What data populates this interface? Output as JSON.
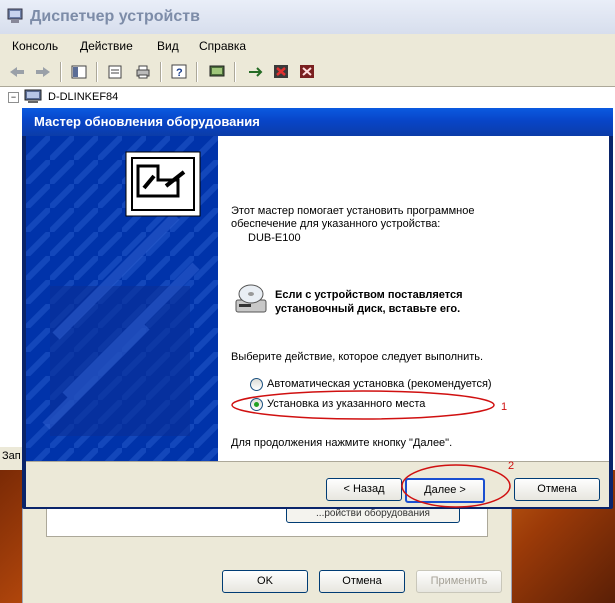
{
  "device_manager": {
    "title": "Диспетчер устройств",
    "menu": [
      "Консоль",
      "Действие",
      "Вид",
      "Справка"
    ],
    "toolbar_icons": [
      "back-icon",
      "forward-icon",
      "show-hide-tree-icon",
      "properties-icon",
      "print-icon",
      "help-icon",
      "scan-hardware-icon",
      "update-driver-icon",
      "disable-device-icon",
      "uninstall-device-icon"
    ],
    "tree_root": "D-DLINKEF84",
    "status_fragment": "Зап"
  },
  "wizard": {
    "title": "Мастер обновления оборудования",
    "intro_line1": "Этот мастер помогает установить программное",
    "intro_line2": "обеспечение для указанного устройства:",
    "device_name": "DUB-E100",
    "cd_prompt_line1": "Если с устройством поставляется",
    "cd_prompt_line2": "установочный диск, вставьте его.",
    "choose_action": "Выберите действие, которое следует выполнить.",
    "options": [
      {
        "label": "Автоматическая установка (рекомендуется)",
        "selected": false
      },
      {
        "label": "Установка из указанного места",
        "selected": true
      }
    ],
    "continue_hint": "Для продолжения нажмите кнопку \"Далее\".",
    "buttons": {
      "back": "< Назад",
      "next": "Далее >",
      "cancel": "Отмена"
    }
  },
  "properties_dialog": {
    "buttons": {
      "ok": "OK",
      "cancel": "Отмена",
      "apply": "Применить"
    },
    "hidden_button": "...ройстви оборудования"
  },
  "annotations": {
    "marker1": "1",
    "marker2": "2",
    "color": "#d01010"
  },
  "colors": {
    "wizard_blue": "#0033aa",
    "titlebar_blue": "#0a5ae0",
    "dialog_gray": "#ece9d8"
  }
}
